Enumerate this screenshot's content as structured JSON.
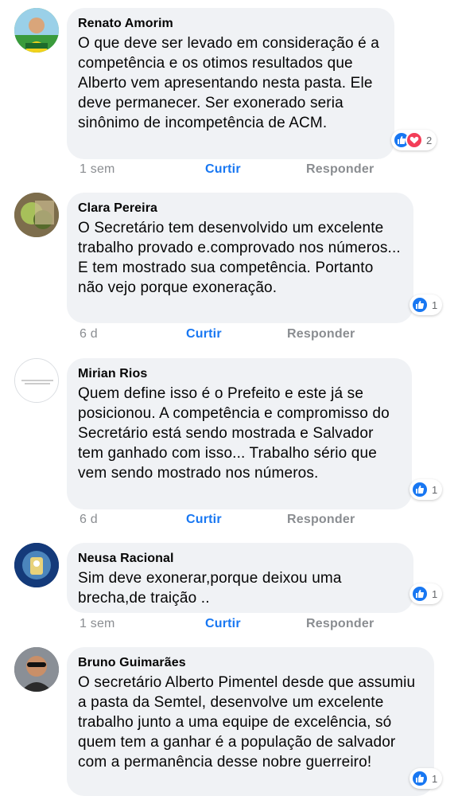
{
  "comments": [
    {
      "author": "Renato Amorim",
      "text": "O que deve ser levado em consideração é a competência e os otimos resultados que Alberto vem apresentando nesta pasta. Ele deve permanecer. Ser exonerado seria sinônimo de incompetência de ACM.",
      "reaction_count": "2",
      "time": "1 sem",
      "like_label": "Curtir",
      "reply_label": "Responder",
      "reactions": [
        "like",
        "love"
      ]
    },
    {
      "author": "Clara Pereira",
      "text": "O Secretário tem desenvolvido um excelente trabalho provado e.comprovado nos números... E tem mostrado sua competência. Portanto não vejo porque exoneração.",
      "reaction_count": "1",
      "time": "6 d",
      "like_label": "Curtir",
      "reply_label": "Responder",
      "reactions": [
        "like"
      ]
    },
    {
      "author": "Mirian Rios",
      "text": "Quem define isso é o Prefeito e este já se posicionou. A competência e compromisso do Secretário está sendo mostrada e Salvador tem ganhado com isso... Trabalho sério que vem sendo mostrado nos números.",
      "reaction_count": "1",
      "time": "6 d",
      "like_label": "Curtir",
      "reply_label": "Responder",
      "reactions": [
        "like"
      ]
    },
    {
      "author": "Neusa Racional",
      "text": "Sim deve exonerar,porque deixou uma brecha,de traição ..",
      "reaction_count": "1",
      "time": "1 sem",
      "like_label": "Curtir",
      "reply_label": "Responder",
      "reactions": [
        "like"
      ]
    },
    {
      "author": "Bruno Guimarães",
      "text": "O secretário Alberto Pimentel desde que assumiu a pasta da Semtel, desenvolve um excelente trabalho junto a uma equipe de excelência, só quem tem a ganhar é a população de salvador com a permanência desse nobre  guerreiro!",
      "reaction_count": "1",
      "reactions": [
        "like"
      ]
    }
  ],
  "colors": {
    "like_blue": "#1877f2",
    "love_red": "#f33e58",
    "bubble_bg": "#f0f2f5",
    "meta_gray": "#8a8d91"
  }
}
